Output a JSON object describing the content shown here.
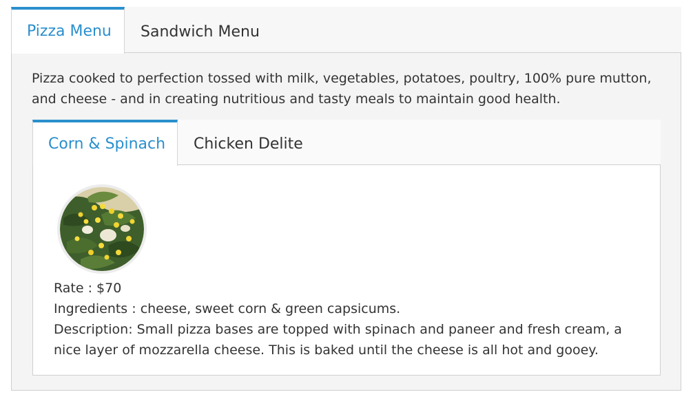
{
  "outer_tabs": [
    {
      "label": "Pizza Menu",
      "active": true
    },
    {
      "label": "Sandwich Menu",
      "active": false
    }
  ],
  "intro_text": "Pizza cooked to perfection tossed with milk, vegetables, potatoes, poultry, 100% pure mutton, and cheese - and in creating nutritious and tasty meals to maintain good health.",
  "inner_tabs": [
    {
      "label": "Corn & Spinach",
      "active": true
    },
    {
      "label": "Chicken Delite",
      "active": false
    }
  ],
  "item": {
    "rate": "Rate : $70",
    "ingredients": "Ingredients : cheese, sweet corn & green capsicums.",
    "description": "Description: Small pizza bases are topped with spinach and paneer and fresh cream, a nice layer of mozzarella cheese. This is baked until the cheese is all hot and gooey."
  },
  "colors": {
    "accent": "#2a8fcd",
    "text": "#333333",
    "panel_bg": "#f4f4f4",
    "border": "#cfcfcf"
  }
}
